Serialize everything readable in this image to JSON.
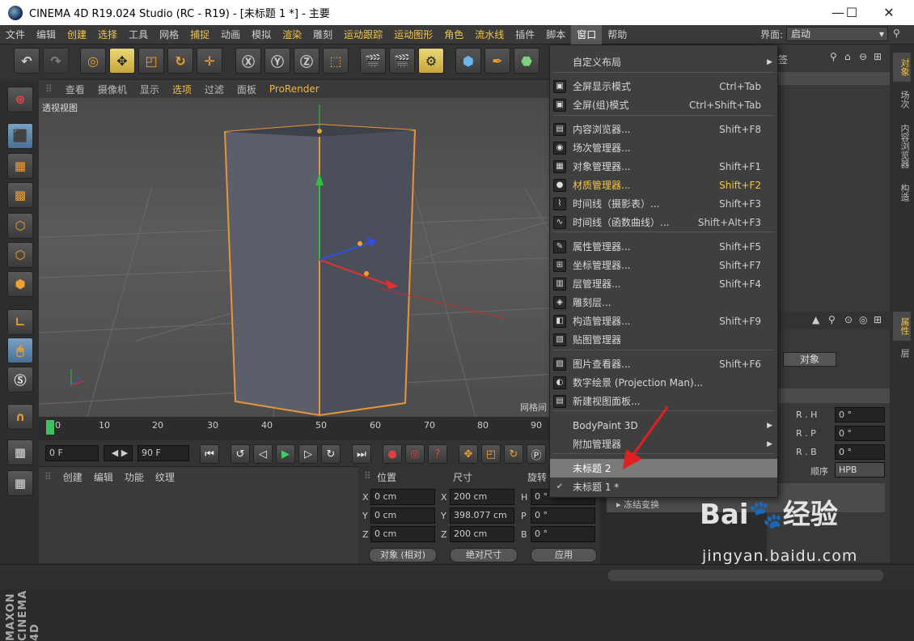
{
  "window": {
    "title": "CINEMA 4D R19.024 Studio (RC - R19) - [未标题 1 *] - 主要",
    "minimize": "—",
    "maximize": "☐",
    "close": "✕"
  },
  "menubar": [
    "文件",
    "编辑",
    "创建",
    "选择",
    "工具",
    "网格",
    "捕捉",
    "动画",
    "模拟",
    "渲染",
    "雕刻",
    "运动跟踪",
    "运动图形",
    "角色",
    "流水线",
    "插件",
    "脚本",
    "窗口",
    "帮助"
  ],
  "layout": {
    "label": "界面:",
    "value": "启动"
  },
  "viewport": {
    "menu": [
      "查看",
      "摄像机",
      "显示",
      "选项",
      "过滤",
      "面板",
      "ProRender"
    ],
    "label": "透视视图",
    "grid_info": "网格间"
  },
  "timeline": {
    "ticks": [
      "0",
      "10",
      "20",
      "30",
      "40",
      "50",
      "60",
      "70",
      "80",
      "90"
    ],
    "start_frame": "0 F",
    "end_frame": "90 F"
  },
  "material_menu": [
    "创建",
    "编辑",
    "功能",
    "纹理"
  ],
  "coordinates": {
    "headers": [
      "位置",
      "尺寸",
      "旋转"
    ],
    "position": [
      {
        "axis": "X",
        "value": "0 cm"
      },
      {
        "axis": "Y",
        "value": "0 cm"
      },
      {
        "axis": "Z",
        "value": "0 cm"
      }
    ],
    "size": [
      {
        "axis": "X",
        "value": "200 cm"
      },
      {
        "axis": "Y",
        "value": "398.077 cm"
      },
      {
        "axis": "Z",
        "value": "200 cm"
      }
    ],
    "rotation": [
      {
        "axis": "H",
        "value": "0 °"
      },
      {
        "axis": "P",
        "value": "0 °"
      },
      {
        "axis": "B",
        "value": "0 °"
      }
    ],
    "mode": "对象 (相对)",
    "size_mode": "绝对尺寸",
    "apply": "应用"
  },
  "right_panel": {
    "tab_label": "签",
    "object_button": "对象",
    "rot_fields": [
      {
        "label": "R . H",
        "value": "0 °"
      },
      {
        "label": "R . P",
        "value": "0 °"
      },
      {
        "label": "R . B",
        "value": "0 °"
      }
    ],
    "order_label": "顺序",
    "order_value": "HPB",
    "freeze": "冻结变换"
  },
  "side_tabs": [
    "对象",
    "场次",
    "内容浏览器",
    "构造"
  ],
  "side_tabs2": [
    "属性",
    "层"
  ],
  "dropdown": {
    "items": [
      {
        "label": "自定义布局",
        "shortcut": "",
        "submenu": true,
        "icon": ""
      },
      {
        "label": "全屏显示模式",
        "shortcut": "Ctrl+Tab",
        "icon": "▣"
      },
      {
        "label": "全屏(组)模式",
        "shortcut": "Ctrl+Shift+Tab",
        "icon": "▣"
      },
      {
        "label": "内容浏览器...",
        "shortcut": "Shift+F8",
        "icon": "▤"
      },
      {
        "label": "场次管理器...",
        "shortcut": "",
        "icon": "◉"
      },
      {
        "label": "对象管理器...",
        "shortcut": "Shift+F1",
        "icon": "▦"
      },
      {
        "label": "材质管理器...",
        "shortcut": "Shift+F2",
        "icon": "●",
        "highlight": true
      },
      {
        "label": "时间线（摄影表）...",
        "shortcut": "Shift+F3",
        "icon": "⌇"
      },
      {
        "label": "时间线（函数曲线）...",
        "shortcut": "Shift+Alt+F3",
        "icon": "∿"
      },
      {
        "label": "属性管理器...",
        "shortcut": "Shift+F5",
        "icon": "✎"
      },
      {
        "label": "坐标管理器...",
        "shortcut": "Shift+F7",
        "icon": "⊞"
      },
      {
        "label": "层管理器...",
        "shortcut": "Shift+F4",
        "icon": "▥"
      },
      {
        "label": "雕刻层...",
        "shortcut": "",
        "icon": "◈"
      },
      {
        "label": "构造管理器...",
        "shortcut": "Shift+F9",
        "icon": "◧"
      },
      {
        "label": "贴图管理器",
        "shortcut": "",
        "icon": "▧"
      },
      {
        "label": "图片查看器...",
        "shortcut": "Shift+F6",
        "icon": "▨"
      },
      {
        "label": "数字绘景 (Projection Man)...",
        "shortcut": "",
        "icon": "◐"
      },
      {
        "label": "新建视图面板...",
        "shortcut": "",
        "icon": "▤"
      },
      {
        "label": "BodyPaint 3D",
        "shortcut": "",
        "submenu": true,
        "icon": ""
      },
      {
        "label": "附加管理器",
        "shortcut": "",
        "submenu": true,
        "icon": ""
      },
      {
        "label": "未标题 2",
        "shortcut": "",
        "icon": "",
        "selected": true
      },
      {
        "label": "未标题 1 *",
        "shortcut": "",
        "icon": "✔"
      }
    ]
  },
  "watermark": {
    "brand": "Bai🐾经验",
    "url": "jingyan.baidu.com"
  },
  "brand_vertical": "MAXON CINEMA 4D",
  "colors": {
    "accent": "#f0a030",
    "highlight": "#f3c74a",
    "selection": "#7a7a7a",
    "axis_x": "#e03030",
    "axis_y": "#30c040",
    "axis_z": "#3050e0"
  }
}
